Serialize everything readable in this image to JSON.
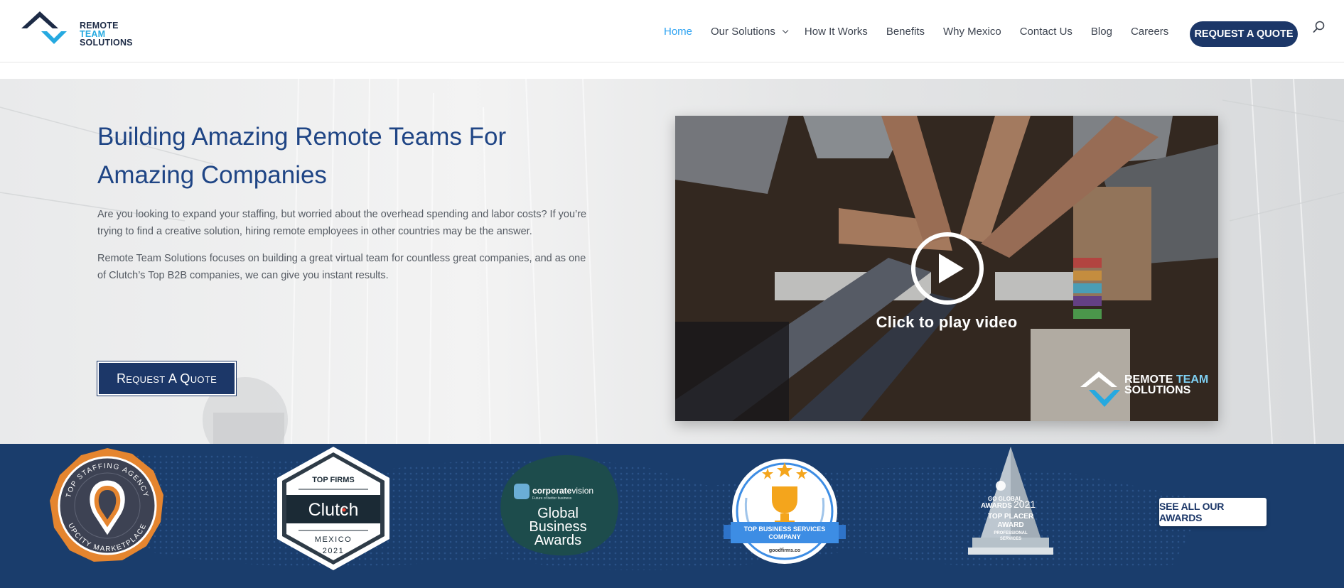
{
  "brand": {
    "name_line1_a": "REMOTE",
    "name_line1_b": "TEAM",
    "name_line2": "SOLUTIONS"
  },
  "nav": {
    "items": [
      {
        "label": "Home",
        "active": true
      },
      {
        "label": "Our Solutions",
        "dropdown": true
      },
      {
        "label": "How It Works"
      },
      {
        "label": "Benefits"
      },
      {
        "label": "Why Mexico"
      },
      {
        "label": "Contact Us"
      },
      {
        "label": "Blog"
      },
      {
        "label": "Careers"
      }
    ],
    "cta_label": "REQUEST A QUOTE",
    "search_icon": "search-icon"
  },
  "hero": {
    "title": "Building Amazing Remote Teams For Amazing Companies",
    "paragraph1": "Are you looking to expand your staffing, but worried about the overhead spending and labor costs? If you’re trying to find a creative solution, hiring remote employees in other countries may be the answer.",
    "paragraph2": "Remote Team Solutions focuses on building a great virtual team for countless great companies, and as one of Clutch’s Top B2B companies, we can give you instant results.",
    "button_label": "Request A Quote"
  },
  "video": {
    "caption": "Click to play video",
    "logo_line1_a": "REMOTE",
    "logo_line1_b": "TEAM",
    "logo_line2": "SOLUTIONS"
  },
  "awards": {
    "upcity": {
      "top": "TOP STAFFING AGENCY",
      "bottom": "UPCITY MARKETPLACE"
    },
    "clutch": {
      "top": "TOP FIRMS",
      "name": "Clutch",
      "country": "MEXICO",
      "year": "2021"
    },
    "corporate_vision": {
      "brand_a": "corporate",
      "brand_b": "vision",
      "tagline": "Future of better business",
      "line1": "Global",
      "line2": "Business",
      "line3": "Awards"
    },
    "goodfirms": {
      "line1": "TOP BUSINESS SERVICES",
      "line2": "COMPANY",
      "site": "goodfirms.co"
    },
    "goglobal": {
      "line1": "GO GLOBAL",
      "line2": "AWARDS",
      "year": "2021",
      "line3": "TOP PLACER",
      "line4": "AWARD",
      "line5": "PROFESSIONAL",
      "line6": "SERVICES"
    },
    "see_all_label": "SEE ALL OUR AWARDS"
  },
  "colors": {
    "navy": "#1c3768",
    "nav_active": "#2ea3f2",
    "awards_band": "#1a3d6c",
    "title_blue": "#1f4585"
  }
}
